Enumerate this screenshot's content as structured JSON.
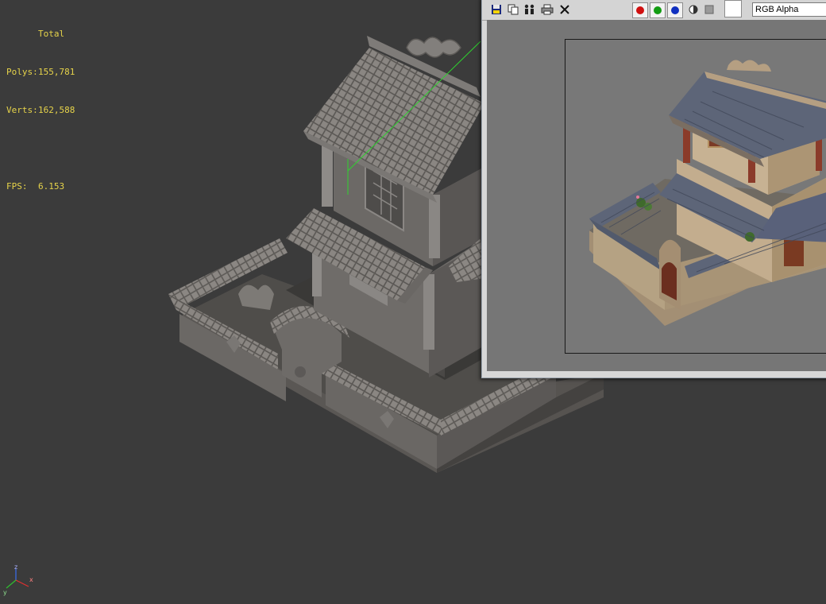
{
  "viewport": {
    "stats": {
      "total_label": "Total",
      "polys_label": "Polys:",
      "polys_value": "155,781",
      "verts_label": "Verts:",
      "verts_value": "162,588",
      "fps_label": "FPS:",
      "fps_value": "6.153"
    },
    "axis": {
      "x": "x",
      "y": "y",
      "z": "z"
    }
  },
  "render_window": {
    "toolbar": {
      "icons": [
        "save-icon",
        "clone-icon",
        "users-icon",
        "print-icon",
        "clear-icon"
      ],
      "channels": [
        {
          "name": "red-channel",
          "color": "#d01010"
        },
        {
          "name": "green-channel",
          "color": "#119c11"
        },
        {
          "name": "blue-channel",
          "color": "#1030c0"
        }
      ],
      "channel_display": "RGB Alpha"
    }
  },
  "colors": {
    "viewport_bg": "#3b3b3b",
    "stats_text": "#e6d34a",
    "model_gray": "#8f8b87",
    "roof_tile": "#5d6578",
    "wall_tan": "#b9a589",
    "pillar_red": "#8b3b2a"
  }
}
